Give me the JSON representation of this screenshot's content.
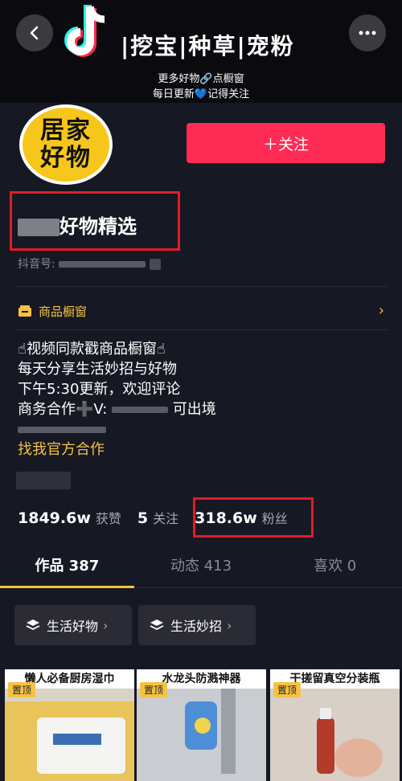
{
  "banner": {
    "tags": "|挖宝|种草|宠粉",
    "line1": "更多好物🔗点橱窗",
    "line2": "每日更新💙记得关注"
  },
  "profile": {
    "avatar_line1": "居家",
    "avatar_line2": "好物",
    "follow_label": "＋关注",
    "name_visible": "好物精选",
    "douyin_id_label": "抖音号:"
  },
  "shop_window": {
    "label": "商品橱窗"
  },
  "bio": {
    "line1": "☝视频同款戳商品橱窗☝",
    "line2": "每天分享生活妙招与好物",
    "line3": "下午5:30更新，欢迎评论",
    "line4_prefix": "商务合作➕V:",
    "line4_suffix": "可出境",
    "link": "找我官方合作"
  },
  "stats": {
    "likes_num": "1849.6w",
    "likes_label": "获赞",
    "following_num": "5",
    "following_label": "关注",
    "fans_num": "318.6w",
    "fans_label": "粉丝"
  },
  "tabs": [
    {
      "label": "作品 387"
    },
    {
      "label": "动态 413"
    },
    {
      "label": "喜欢 0"
    }
  ],
  "collections": [
    {
      "label": "生活好物"
    },
    {
      "label": "生活妙招"
    }
  ],
  "videos": [
    {
      "caption": "懒人必备厨房湿巾",
      "pin": "置顶"
    },
    {
      "caption": "水龙头防溅神器",
      "pin": "置顶"
    },
    {
      "caption": "干搓留真空分装瓶",
      "pin": "置顶"
    }
  ],
  "colors": {
    "background": "#161823",
    "follow": "#fe2c55",
    "accent": "#f5c242",
    "highlight_box": "#e31b23"
  }
}
